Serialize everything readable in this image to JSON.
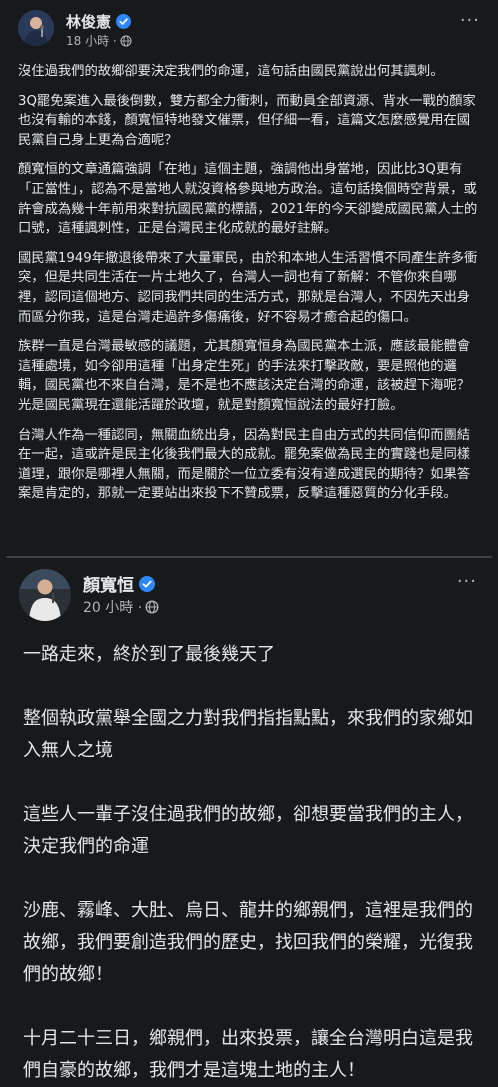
{
  "post": {
    "author": "林俊憲",
    "timestamp": "18 小時 · ",
    "paragraphs": [
      "沒住過我們的故鄉卻要決定我們的命運，這句話由國民黨說出何其諷刺。",
      "3Q罷免案進入最後倒數，雙方都全力衝刺，而動員全部資源、背水一戰的顏家也沒有輸的本錢，顏寬恒特地發文催票，但仔細一看，這篇文怎麼感覺用在國民黨自己身上更為合適呢？",
      "顏寬恒的文章通篇強調「在地」這個主題，強調他出身當地，因此比3Q更有「正當性」，認為不是當地人就沒資格參與地方政治。這句話換個時空背景，或許會成為幾十年前用來對抗國民黨的標語，2021年的今天卻變成國民黨人士的口號，這種諷刺性，正是台灣民主化成就的最好註解。",
      "國民黨1949年撤退後帶來了大量軍民，由於和本地人生活習慣不同產生許多衝突，但是共同生活在一片土地久了，台灣人一詞也有了新解：不管你來自哪裡，認同這個地方、認同我們共同的生活方式，那就是台灣人，不因先天出身而區分你我，這是台灣走過許多傷痛後，好不容易才癒合起的傷口。",
      "族群一直是台灣最敏感的議題，尤其顏寬恒身為國民黨本土派，應該最能體會這種處境，如今卻用這種「出身定生死」的手法來打擊政敵，要是照他的邏輯，國民黨也不來自台灣，是不是也不應該決定台灣的命運，該被趕下海呢？光是國民黨現在還能活躍於政壇，就是對顏寬恒說法的最好打臉。",
      "台灣人作為一種認同，無關血統出身，因為對民主自由方式的共同信仰而團結在一起，這或許是民主化後我們最大的成就。罷免案做為民主的實踐也是同樣道理，跟你是哪裡人無關，而是關於一位立委有沒有達成選民的期待？如果答案是肯定的，那就一定要站出來投下不贊成票，反擊這種惡質的分化手段。"
    ],
    "icons": {
      "verified": "verified-badge-icon",
      "audience": "globe-icon",
      "more": "more-options-icon"
    },
    "colors": {
      "verified": "#2d88ff",
      "text": "#e4e6eb",
      "meta": "#b0b3b8"
    }
  },
  "shared_post": {
    "author": "顏寬恒",
    "timestamp": "20 小時 · ",
    "paragraphs": [
      "一路走來，終於到了最後幾天了",
      "整個執政黨舉全國之力對我們指指點點，來我們的家鄉如入無人之境",
      "這些人一輩子沒住過我們的故鄉，卻想要當我們的主人，決定我們的命運",
      "沙鹿、霧峰、大肚、烏日、龍井的鄉親們，這裡是我們的故鄉，我們要創造我們的歷史，找回我們的榮耀，光復我們的故鄉！",
      "十月二十三日，鄉親們，出來投票，讓全台灣明白這是我們自豪的故鄉，我們才是這塊土地的主人！"
    ]
  }
}
